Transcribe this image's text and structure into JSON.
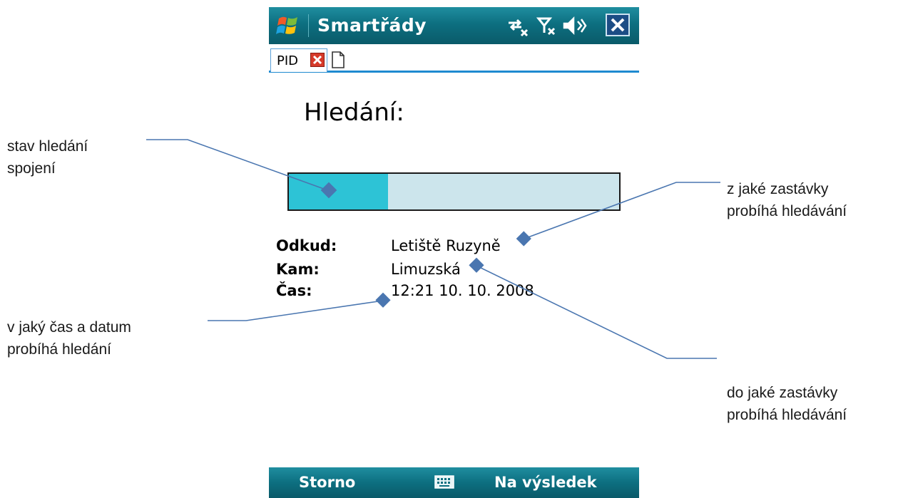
{
  "app": {
    "title": "Smartřády",
    "tab_label": "PID"
  },
  "icons": {
    "start": "windows-start-icon",
    "connectivity": "data-connection-off-icon",
    "signal": "signal-off-icon",
    "volume": "speaker-icon",
    "close": "close-icon",
    "tab_close": "tab-close-icon",
    "new_tab": "new-document-icon",
    "keyboard": "keyboard-icon"
  },
  "search": {
    "heading": "Hledání:",
    "progress_fraction": 0.3,
    "from_label": "Odkud:",
    "from_value": "Letiště Ruzyně",
    "to_label": "Kam:",
    "to_value": "Limuzská",
    "time_label": "Čas:",
    "time_value": "12:21 10. 10. 2008"
  },
  "softkeys": {
    "left": "Storno",
    "right": "Na výsledek"
  },
  "annotations": {
    "progress_line1": "stav hledání",
    "progress_line2": "spojení",
    "from_line1": "z jaké zastávky",
    "from_line2": "probíhá hledávání",
    "time_line1": "v jaký čas a datum",
    "time_line2": "probíhá hledání",
    "to_line1": "do jaké zastávky",
    "to_line2": "probíhá hledávání"
  },
  "colors": {
    "bar_teal": "#0d6f80",
    "progress_fill": "#2dc3d6",
    "progress_track": "#cce5ec",
    "annotation_line": "#4a76b0"
  }
}
